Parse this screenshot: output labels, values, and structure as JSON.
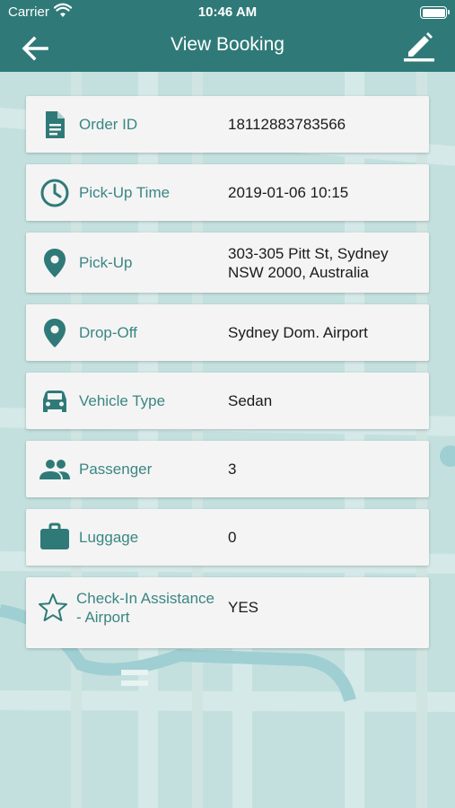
{
  "status_bar": {
    "carrier": "Carrier",
    "time": "10:46 AM"
  },
  "nav": {
    "title": "View Booking",
    "back_icon": "arrow-left-icon",
    "edit_icon": "pencil-icon"
  },
  "colors": {
    "primary": "#2f7a78",
    "label": "#3a8684",
    "card_bg": "#f4f4f4",
    "map_bg": "#c3e0df"
  },
  "booking": {
    "order_id": {
      "label": "Order ID",
      "value": "18112883783566",
      "icon": "document-icon"
    },
    "pickup_time": {
      "label": "Pick-Up Time",
      "value": "2019-01-06 10:15",
      "icon": "clock-icon"
    },
    "pickup": {
      "label": "Pick-Up",
      "value_line1": "303-305 Pitt St, Sydney",
      "value_line2": "NSW 2000, Australia",
      "icon": "location-pin-icon"
    },
    "dropoff": {
      "label": "Drop-Off",
      "value": "Sydney Dom. Airport",
      "icon": "location-pin-icon"
    },
    "vehicle": {
      "label": "Vehicle Type",
      "value": "Sedan",
      "icon": "car-icon"
    },
    "passenger": {
      "label": "Passenger",
      "value": "3",
      "icon": "people-icon"
    },
    "luggage": {
      "label": "Luggage",
      "value": "0",
      "icon": "briefcase-icon"
    },
    "checkin": {
      "label_line1": "Check-In Assistance",
      "label_line2": "- Airport",
      "value": "YES",
      "icon": "star-outline-icon"
    }
  }
}
